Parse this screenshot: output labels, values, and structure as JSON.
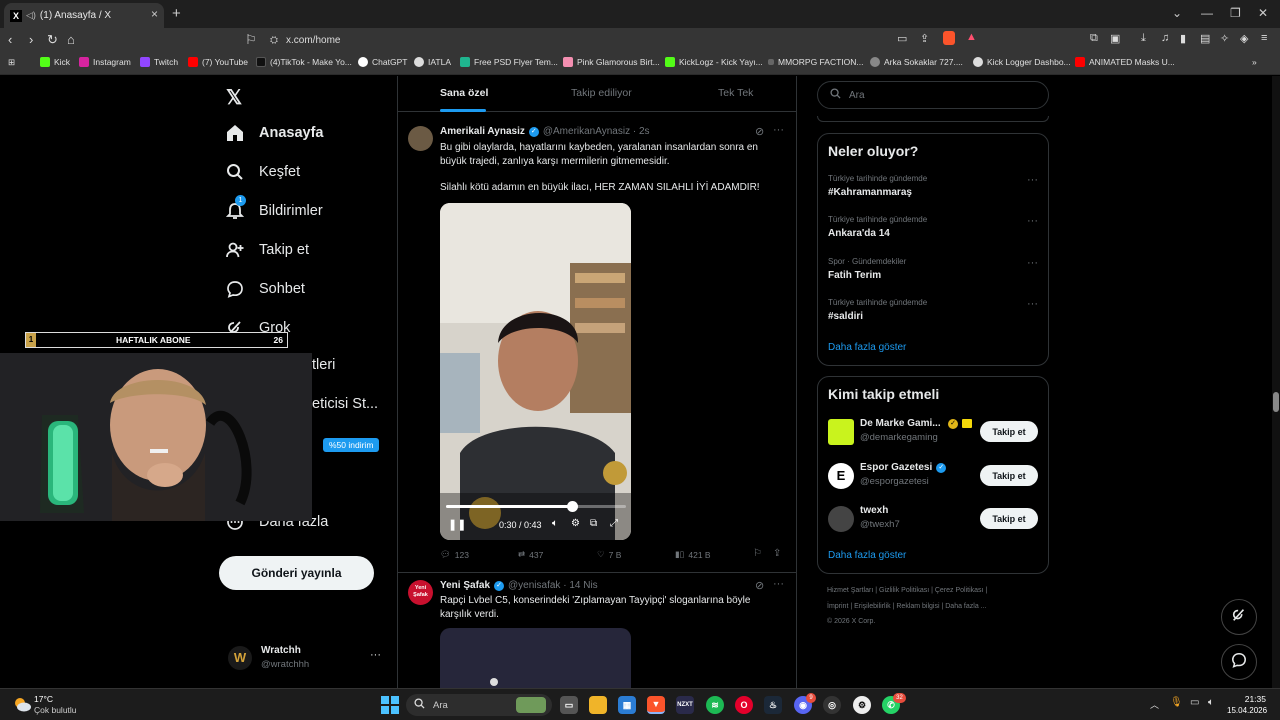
{
  "browser": {
    "tab_title": "(1) Anasayfa / X",
    "tab_close": "×",
    "new_tab": "+",
    "url": "x.com/home",
    "bookmarks": [
      "Kick",
      "Instagram",
      "Twitch",
      "(7) YouTube",
      "(4)TikTok - Make Yo...",
      "ChatGPT",
      "IATLA",
      "Free PSD Flyer Tem...",
      "Pink Glamorous Birt...",
      "KickLogz - Kick Yayı...",
      "MMORPG FACTION...",
      "Arka Sokaklar 727....",
      "Kick Logger Dashbo...",
      "ANIMATED Masks U..."
    ]
  },
  "nav": {
    "items": [
      "Anasayfa",
      "Keşfet",
      "Bildirimler",
      "Takip et",
      "Sohbet",
      "Grok",
      "tleri",
      "eticisi St...",
      "Daha fazla"
    ],
    "notif_count": "1",
    "premium_badge": "%50 indirim",
    "post_button": "Gönderi yayınla",
    "account_name": "Wratchh",
    "account_handle": "@wratchhh",
    "more": "···"
  },
  "overlay": {
    "rank": "1",
    "label": "HAFTALIK ABONE",
    "count": "26"
  },
  "feed": {
    "tabs": [
      "Sana özel",
      "Takip ediliyor",
      "Tek Tek"
    ],
    "tweet1": {
      "name": "Amerikali Aynasiz",
      "handle": "@AmerikanAynasiz · 2s",
      "text1": "Bu gibi olaylarda, hayatlarını kaybeden, yaralanan insanlardan sonra en büyük trajedi, zanlıya karşı mermilerin gitmemesidir.",
      "text2": "Silahlı kötü adamın en büyük ilacı, HER ZAMAN SILAHLI İYİ ADAMDIR!",
      "video_time": "0:30 / 0:43",
      "video_progress": 0.698,
      "replies": "123",
      "retweets": "437",
      "likes": "7 B",
      "views": "421 B"
    },
    "tweet2": {
      "avatar_text": "Yeni Şafak",
      "name": "Yeni Şafak",
      "handle": "@yenisafak · 14 Nis",
      "text": "Rapçi Lvbel C5, konserindeki 'Zıplamayan Tayyipçi' sloganlarına böyle karşılık verdi."
    }
  },
  "sidebar": {
    "search_placeholder": "Ara",
    "trends_title": "Neler oluyor?",
    "trends": [
      {
        "context": "Türkiye tarihinde gündemde",
        "name": "#Kahramanmaraş"
      },
      {
        "context": "Türkiye tarihinde gündemde",
        "name": "Ankara'da 14"
      },
      {
        "context": "Spor · Gündemdekiler",
        "name": "Fatih Terim"
      },
      {
        "context": "Türkiye tarihinde gündemde",
        "name": "#saldiri"
      }
    ],
    "show_more": "Daha fazla göster",
    "who_title": "Kimi takip etmeli",
    "who": [
      {
        "name": "De Marke Gami...",
        "handle": "@demarkegaming",
        "button": "Takip et"
      },
      {
        "name": "Espor Gazetesi",
        "handle": "@esporgazetesi",
        "button": "Takip et"
      },
      {
        "name": "twexh",
        "handle": "@twexh7",
        "button": "Takip et"
      }
    ],
    "who_show_more": "Daha fazla göster",
    "footer_line1": "Hizmet Şartları  |  Gizlilik Politikası  |  Çerez Politikası  |",
    "footer_line2": "İmprint  |  Erişilebilirlik  |  Reklam bilgisi  |  Daha fazla ...",
    "footer_line3": "© 2026 X Corp."
  },
  "taskbar": {
    "weather_temp": "17°C",
    "weather_desc": "Çok bulutlu",
    "search": "Ara",
    "time": "21:35",
    "date": "15.04.2026",
    "badge_discord": "9",
    "badge_whatsapp": "32"
  }
}
